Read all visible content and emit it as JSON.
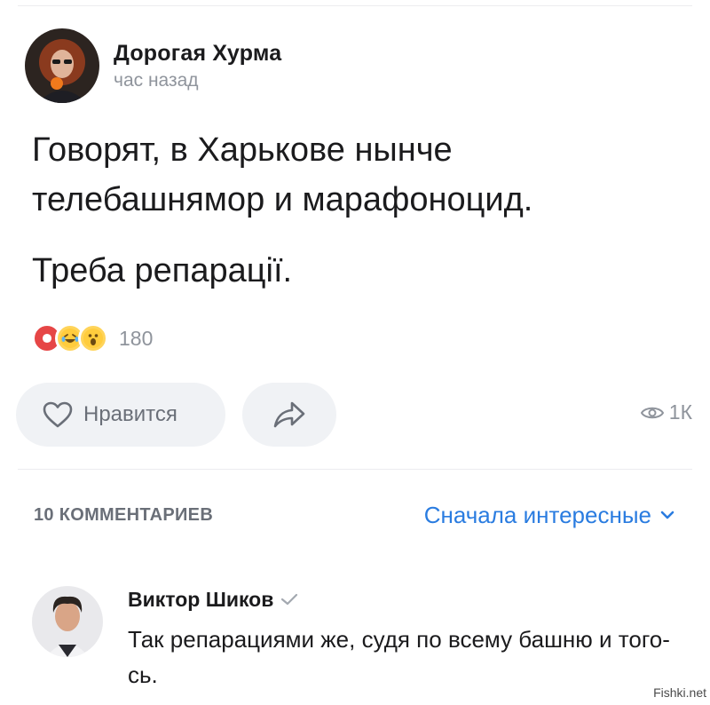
{
  "post": {
    "author": "Дорогая Хурма",
    "time": "час назад",
    "paragraphs": [
      "Говорят, в Харькове нынче телебашнямор и марафоноцид.",
      "Треба репарації."
    ],
    "reactions": {
      "icons": [
        "heart-reaction-icon",
        "laughing-tears-reaction-icon",
        "surprised-reaction-icon"
      ],
      "count": "180"
    }
  },
  "actions": {
    "like_label": "Нравится",
    "views": "1К"
  },
  "comments_header": {
    "count_label": "10 КОММЕНТАРИЕВ",
    "sort_label": "Сначала интересные"
  },
  "comment": {
    "author": "Виктор Шиков",
    "text": "Так репарациями же, судя по всему башню и того-сь."
  },
  "watermark": "Fishki.net",
  "colors": {
    "accent": "#2a7ce0",
    "secondary_text": "#8f949c",
    "button_bg": "#f0f2f5",
    "heart": "#e64646"
  }
}
